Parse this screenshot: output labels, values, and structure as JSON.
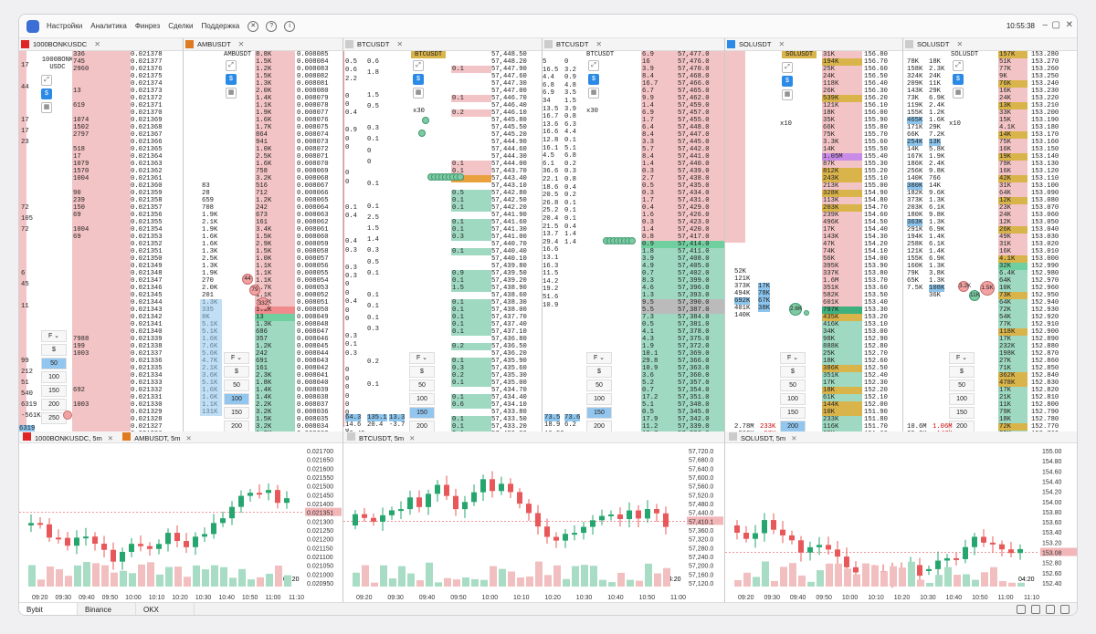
{
  "app": {
    "menu": [
      "Настройки",
      "Аналитика",
      "Финрез",
      "Сделки",
      "Поддержка"
    ],
    "clock": "10:55:38"
  },
  "colors": {
    "ask": "#f3c4c6",
    "bid": "#9fd9c1",
    "accent": "#2a8ae6",
    "red": "#e8585a",
    "green": "#26a66e"
  },
  "panels": [
    {
      "id": "bonk",
      "label": "1000BONKUSDC",
      "color": "#e02424",
      "ladder_label": "1000BONK USDC",
      "ask_prices": [
        "0.021378",
        "0.021377",
        "0.021376",
        "0.021375",
        "0.021374",
        "0.021373",
        "0.021372",
        "0.021371",
        "0.021370",
        "0.021369",
        "0.021368",
        "0.021367",
        "0.021366",
        "0.021365",
        "0.021364",
        "0.021363",
        "0.021362",
        "0.021361",
        "0.021360",
        "0.021359",
        "0.021358",
        "0.021357",
        "0.021356",
        "0.021355",
        "0.021354",
        "0.021353",
        "0.021352",
        "0.021351",
        "0.021350",
        "0.021349",
        "0.021348",
        "0.021347",
        "0.021346",
        "0.021345",
        "0.021344",
        "0.021343"
      ],
      "ask_vols": [
        "336",
        "745",
        "2960",
        "",
        "",
        "13",
        "",
        "619",
        "",
        "1074",
        "1502",
        "2797",
        "",
        "518",
        "17",
        "1079",
        "1570",
        "1004",
        "",
        "90",
        "239",
        "150",
        "69",
        "",
        "1004",
        "69",
        "",
        "",
        "",
        "",
        "",
        "",
        "",
        "",
        "",
        ""
      ],
      "bid_prices": [
        "0.021342",
        "0.021341",
        "0.021340",
        "0.021339",
        "0.021338",
        "0.021337",
        "0.021336",
        "0.021335",
        "0.021334",
        "0.021333",
        "0.021332",
        "0.021331",
        "0.021330",
        "0.021329",
        "0.021328",
        "0.021327",
        "0.021326",
        "0.021325",
        "0.021324",
        "0.021323",
        "0.021322",
        "0.021321",
        "0.021320",
        "0.021319",
        "0.021318",
        "0.021317",
        "0.021316",
        "0.021315",
        "0.021314"
      ],
      "bid_vols": [
        "",
        "",
        "",
        "7988",
        "199",
        "1003",
        "",
        "",
        "",
        "",
        "692",
        "",
        "1003",
        "",
        "",
        "",
        "",
        "",
        "",
        "",
        "",
        "",
        "",
        "",
        "",
        "",
        "",
        "",
        "1808"
      ],
      "left_numbers": [
        "17",
        "",
        "44",
        "",
        "",
        "17",
        "17",
        "23",
        "",
        "",
        "",
        "",
        "",
        "72",
        "105",
        "72",
        "",
        "",
        "",
        "6",
        "45",
        "",
        "11",
        "",
        "",
        "",
        "",
        "99",
        "212",
        "51",
        "540",
        "6319",
        "-561K"
      ],
      "bottom": {
        "v1": "6319",
        "v2": "-561K"
      }
    },
    {
      "id": "amb",
      "label": "AMBUSDT",
      "color": "#e07a20",
      "ladder_label": "AMBUSDT",
      "ask_prices": [
        "0.008085",
        "0.008084",
        "0.008083",
        "0.008082",
        "0.008081",
        "0.008080",
        "0.008079",
        "0.008078",
        "0.008077",
        "0.008076",
        "0.008075",
        "0.008074",
        "0.008073",
        "0.008072",
        "0.008071",
        "0.008070",
        "0.008069",
        "0.008068",
        "0.008067",
        "0.008066",
        "0.008065",
        "0.008064",
        "0.008063",
        "0.008062",
        "0.008061",
        "0.008060",
        "0.008059",
        "0.008058",
        "0.008057",
        "0.008056",
        "0.008055",
        "0.008054",
        "0.008053",
        "0.008052",
        "0.008051",
        "0.008050"
      ],
      "ask_vols": [
        "8.8K",
        "1.5K",
        "1.2K",
        "1.5K",
        "1.3K",
        "2.0K",
        "1.4K",
        "1.1K",
        "1.9K",
        "1.6K",
        "1.7K",
        "864",
        "941",
        "1.0K",
        "2.5K",
        "1.6K",
        "758",
        "3.2K",
        "516",
        "712",
        "1.2K",
        "242",
        "673",
        "161",
        "3.4K",
        "1.5K",
        "2.9K",
        "1.5K",
        "1.0K",
        "1.1K",
        "1.1K",
        "1.1K",
        "1.7K",
        "1.1K",
        "1.6K",
        "1.1K"
      ],
      "bid_prices": [
        "0.008049",
        "0.008048",
        "0.008047",
        "0.008046",
        "0.008045",
        "0.008044",
        "0.008043",
        "0.008042",
        "0.008041",
        "0.008040",
        "0.008039",
        "0.008038",
        "0.008037",
        "0.008036",
        "0.008035",
        "0.008034",
        "0.008033",
        "0.008032",
        "0.008031",
        "0.008030"
      ],
      "bid_vols": [
        "13",
        "1.3K",
        "686",
        "357",
        "1.2K",
        "242",
        "691",
        "161",
        "2.3K",
        "1.8K",
        "1.4K",
        "1.4K",
        "2.2K",
        "3.2K",
        "1.5K",
        "3.2K",
        "1.2K",
        "6.2K",
        "1.7K",
        "7.8K"
      ],
      "left_vols": [
        "83",
        "28",
        "659",
        "708",
        "1.9K",
        "2.1K",
        "1.9K",
        "1.6K",
        "1.6K",
        "1.3K",
        "2.5K",
        "1.3K",
        "1.9K",
        "270",
        "2.0K",
        "201",
        "1.3K",
        "335",
        "8K",
        "5.1K",
        "5.1K",
        "1.6K",
        "7.6K",
        "5.6K",
        "4.7K",
        "2.1K",
        "3.6K",
        "5.1K",
        "1.6K",
        "1.6K",
        "1.1K",
        "131K"
      ],
      "bubbles": [
        "44",
        "79",
        "332"
      ]
    },
    {
      "id": "btc1",
      "label": "BTCUSDT",
      "color": "",
      "ladder_label": "BTCUSDT",
      "prices": [
        "57,448.50",
        "57,448.20",
        "57,447.90",
        "57,447.60",
        "57,447.30",
        "57,447.00",
        "57,446.70",
        "57,446.40",
        "57,446.10",
        "57,445.80",
        "57,445.50",
        "57,445.20",
        "57,444.90",
        "57,444.60",
        "57,444.30",
        "57,444.00",
        "57,443.70",
        "57,443.40",
        "57,443.10",
        "57,442.80",
        "57,442.50",
        "57,442.20",
        "57,441.90",
        "57,441.60",
        "57,441.30",
        "57,441.00",
        "57,440.70",
        "57,440.40",
        "57,440.10",
        "57,439.80",
        "57,439.50",
        "57,439.20",
        "57,438.90",
        "57,438.60",
        "57,438.30",
        "57,438.00",
        "57,437.70",
        "57,437.40",
        "57,437.10",
        "57,436.80",
        "57,436.50",
        "57,436.20",
        "57,435.90",
        "57,435.60",
        "57,435.30",
        "57,435.00",
        "57,434.70",
        "57,434.40",
        "57,434.10",
        "57,433.80",
        "57,433.50",
        "57,433.20",
        "57,432.90",
        "57,432.60",
        "57,432.30",
        "57,432.00",
        "57,431.70",
        "57,431.40"
      ],
      "vols": [
        "",
        "",
        "0.1",
        "",
        "",
        "",
        "0.1",
        "",
        "0.2",
        "",
        "",
        "",
        "",
        "",
        "",
        "0.1",
        "0.1",
        "3.1",
        "",
        "0.5",
        "0.1",
        "0.1",
        "",
        "0.1",
        "0.1",
        "0.3",
        "",
        "0.1",
        "",
        "",
        "0.9",
        "0.1",
        "1.5",
        "",
        "0.1",
        "0.1",
        "0.1",
        "0.1",
        "0.1",
        "",
        "0.2",
        "",
        "0.1",
        "0.3",
        "0.2",
        "0.1",
        "",
        "0.1",
        "0.6",
        "",
        "0.1",
        "0.1",
        "0.1",
        "",
        "0.1",
        "0.1",
        "",
        "0.1"
      ],
      "bottom": [
        "64.3",
        "135.1",
        "13.3",
        "14.6",
        "20.4",
        "-3.7"
      ],
      "time": "10:45",
      "time2": "10:50"
    },
    {
      "id": "btc2",
      "label": "BTCUSDT",
      "color": "",
      "ladder_label": "BTCUSDT",
      "prices": [
        "57,477.0",
        "57,476.0",
        "57,470.0",
        "57,468.0",
        "57,466.0",
        "57,465.0",
        "57,462.0",
        "57,459.0",
        "57,457.0",
        "57,455.0",
        "57,448.0",
        "57,447.0",
        "57,445.0",
        "57,442.0",
        "57,441.0",
        "57,440.0",
        "57,439.0",
        "57,438.0",
        "57,435.0",
        "57,434.0",
        "57,431.0",
        "57,429.0",
        "57,426.0",
        "57,423.0",
        "57,420.0",
        "57,417.0",
        "57,414.0",
        "57,411.0",
        "57,408.0",
        "57,405.0",
        "57,402.0",
        "57,399.0",
        "57,396.0",
        "57,393.0",
        "57,390.0",
        "57,387.0",
        "57,384.0",
        "57,381.0",
        "57,378.0",
        "57,375.0",
        "57,372.0",
        "57,369.0",
        "57,366.0",
        "57,363.0",
        "57,360.0",
        "57,357.0",
        "57,354.0",
        "57,351.0",
        "57,348.0",
        "57,345.0",
        "57,342.0",
        "57,339.0",
        "57,336.0",
        "57,333.0",
        "57,330.0",
        "57,327.0",
        "57,324.0",
        "57,321.0",
        "57,318.0",
        "57,315.0",
        "57,312.0",
        "57,309.0",
        "57,306.0"
      ],
      "vols": [
        "6.9",
        "16",
        "3.9",
        "8.4",
        "16.7",
        "6.7",
        "9.9",
        "1.4",
        "6.9",
        "1.7",
        "6.4",
        "8.4",
        "3.3",
        "5.7",
        "8.4",
        "1.4",
        "0.3",
        "2.7",
        "0.5",
        "0.3",
        "1.7",
        "0.4",
        "1.6",
        "0.3",
        "1.4",
        "0.8",
        "0.9",
        "1.8",
        "3.9",
        "4.9",
        "0.7",
        "8.3",
        "4.6",
        "1.3",
        "9.5",
        "5.5",
        "7.3",
        "0.5",
        "4.1",
        "4.3",
        "1.9",
        "10.1",
        "29.8",
        "10.9",
        "3.6",
        "5.2",
        "0.7",
        "17.2",
        "5.1",
        "0.5",
        "17.9",
        "11.2",
        "10.7",
        "18.0",
        "15.5",
        "17.3",
        "10.6",
        "2.4",
        "10.7",
        "5.1",
        "8.3",
        "6.9",
        "2.4"
      ],
      "bottom": [
        "73.5",
        "73.6",
        "18.9",
        "6.2"
      ],
      "time": "10:50"
    },
    {
      "id": "sol1",
      "label": "SOLUSDT",
      "color": "#2a8ae6",
      "ladder_label": "SOLUSDT",
      "prices": [
        "156.80",
        "156.70",
        "156.60",
        "156.50",
        "156.40",
        "156.30",
        "156.20",
        "156.10",
        "156.00",
        "155.90",
        "155.80",
        "155.70",
        "155.60",
        "155.50",
        "155.40",
        "155.30",
        "155.20",
        "155.10",
        "155.00",
        "154.90",
        "154.80",
        "154.70",
        "154.60",
        "154.50",
        "154.40",
        "154.30",
        "154.20",
        "154.10",
        "154.00",
        "153.90",
        "153.80",
        "153.70",
        "153.60",
        "153.50",
        "153.40",
        "153.30",
        "153.20",
        "153.10",
        "153.00",
        "152.90",
        "152.80",
        "152.70",
        "152.60",
        "152.50",
        "152.40",
        "152.30",
        "152.20",
        "152.10",
        "152.00",
        "151.90",
        "151.80",
        "151.70",
        "151.60",
        "151.50",
        "151.40",
        "151.30",
        "151.20",
        "151.10",
        "151.00"
      ],
      "vols": [
        "31K",
        "194K",
        "25K",
        "24K",
        "118K",
        "26K",
        "539K",
        "121K",
        "18K",
        "35K",
        "66K",
        "75K",
        "3.3K",
        "14K",
        "1.05M",
        "87K",
        "812K",
        "243K",
        "213K",
        "328K",
        "113K",
        "203K",
        "239K",
        "496K",
        "17K",
        "143K",
        "47K",
        "74K",
        "56K",
        "395K",
        "337K",
        "1.6M",
        "351K",
        "582K",
        "601K",
        "797K",
        "435K",
        "416K",
        "34K",
        "98K",
        "888K",
        "25K",
        "18K",
        "386K",
        "351K",
        "17K",
        "18K",
        "61K",
        "144K",
        "10K",
        "233K",
        "116K",
        "60K",
        "11K",
        "32K",
        "73K",
        "12K",
        "18K",
        "10K"
      ],
      "mid": [
        "52K",
        "121K",
        "373K",
        "494K",
        "692K",
        "401K",
        "140K"
      ],
      "mid2": [
        "17K",
        "78K",
        "67K",
        "38K"
      ],
      "bottom": [
        "2.78M",
        "233K",
        "-262K",
        "-57K"
      ]
    },
    {
      "id": "sol2",
      "label": "SOLUSDT",
      "color": "",
      "ladder_label": "SOLUSDT",
      "left": [
        "78K",
        "158K",
        "324K",
        "209K",
        "143K",
        "73K",
        "119K",
        "155K",
        "465K",
        "171K",
        "66K",
        "254K",
        "14K",
        "167K",
        "186K",
        "256K",
        "140K",
        "380K",
        "182K",
        "373K",
        "203K",
        "180K",
        "363K",
        "291K",
        "194K",
        "258K",
        "121K",
        "155K",
        "160K",
        "79K",
        "65K",
        "7.5K"
      ],
      "left2": [
        "18K",
        "2.3K",
        "24K",
        "11K",
        "29K",
        "6.9K",
        "2.4K",
        "1.2K",
        "1.6K",
        "29K",
        "7.2K",
        "13K",
        "5.8K",
        "1.9K",
        "2.4K",
        "9.8K",
        "766",
        "14K",
        "9.6K",
        "1.3K",
        "6.1K",
        "9.8K",
        "1.3K",
        "6.9K",
        "1.4K",
        "6.1K",
        "1.4K",
        "6.9K",
        "1.3K",
        "3.8K",
        "1.3K",
        "108K",
        "36K"
      ],
      "prices": [
        "153.280",
        "153.270",
        "153.260",
        "153.250",
        "153.240",
        "153.230",
        "153.220",
        "153.210",
        "153.200",
        "153.190",
        "153.180",
        "153.170",
        "153.160",
        "153.150",
        "153.140",
        "153.130",
        "153.120",
        "153.110",
        "153.100",
        "153.090",
        "153.080",
        "153.070",
        "153.060",
        "153.050",
        "153.040",
        "153.030",
        "153.020",
        "153.010",
        "153.000",
        "152.990",
        "152.980",
        "152.970",
        "152.960",
        "152.950",
        "152.940",
        "152.930",
        "152.920",
        "152.910",
        "152.900",
        "152.890",
        "152.880",
        "152.870",
        "152.860",
        "152.850",
        "152.840",
        "152.830",
        "152.820",
        "152.810",
        "152.800",
        "152.790",
        "152.780",
        "152.770",
        "152.760",
        "152.750",
        "152.740",
        "152.730",
        "152.720",
        "152.710"
      ],
      "vols": [
        "157K",
        "51K",
        "77K",
        "9K",
        "76K",
        "16K",
        "24K",
        "13K",
        "33K",
        "15K",
        "4.1K",
        "14K",
        "75K",
        "16K",
        "19K",
        "79K",
        "16K",
        "42K",
        "31K",
        "64K",
        "12K",
        "23K",
        "24K",
        "12K",
        "26K",
        "49K",
        "31K",
        "16K",
        "4.1K",
        "32K",
        "6.4K",
        "64K",
        "10K",
        "73K",
        "64K",
        "72K",
        "54K",
        "77K",
        "118K",
        "17K",
        "232K",
        "198K",
        "27K",
        "71K",
        "362K",
        "478K",
        "17K",
        "21K",
        "11K",
        "79K",
        "18K",
        "72K",
        "29K",
        "28K",
        "87K",
        "48K",
        "54K",
        "11K"
      ],
      "bottom": [
        "10.6M",
        "1.06M",
        "29.2K",
        "-147K"
      ],
      "bubbles": [
        "3.2K",
        "1.5K",
        "11K"
      ]
    }
  ],
  "charts": [
    {
      "id": "chart-bonk",
      "tabs": [
        "1000BONKUSDC, 5m",
        "AMBUSDT, 5m"
      ],
      "y_labels": [
        "0.021700",
        "0.021650",
        "0.021600",
        "0.021550",
        "0.021500",
        "0.021450",
        "0.021400",
        "0.021351",
        "0.021300",
        "0.021250",
        "0.021200",
        "0.021150",
        "0.021100",
        "0.021050",
        "0.021000",
        "0.020950"
      ],
      "x_labels": [
        "09:20",
        "09:30",
        "09:40",
        "09:50",
        "10:00",
        "10:10",
        "10:20",
        "10:30",
        "10:40",
        "10:50",
        "11:00",
        "11:10"
      ],
      "countdown": "04:20",
      "last": "0.021351"
    },
    {
      "id": "chart-btc",
      "tabs": [
        "BTCUSDT, 5m"
      ],
      "y_labels": [
        "57,720.0",
        "57,680.0",
        "57,640.0",
        "57,600.0",
        "57,560.0",
        "57,520.0",
        "57,480.0",
        "57,440.0",
        "57,410.1",
        "57,360.0",
        "57,320.0",
        "57,280.0",
        "57,240.0",
        "57,200.0",
        "57,160.0",
        "57,120.0"
      ],
      "x_labels": [
        "09:20",
        "09:30",
        "09:40",
        "09:50",
        "10:00",
        "10:10",
        "10:20",
        "10:30",
        "10:40",
        "10:50",
        "11:00"
      ],
      "countdown": "04:20",
      "last": "57,410.1"
    },
    {
      "id": "chart-sol",
      "tabs": [
        "SOLUSDT, 5m"
      ],
      "y_labels": [
        "155.00",
        "154.80",
        "154.60",
        "154.40",
        "154.20",
        "154.00",
        "153.80",
        "153.60",
        "153.40",
        "153.20",
        "153.08",
        "152.80",
        "152.60",
        "152.40"
      ],
      "x_labels": [
        "09:20",
        "09:30",
        "09:40",
        "09:50",
        "10:00",
        "10:10",
        "10:20",
        "10:30",
        "10:40",
        "10:50",
        "11:00",
        "11:10"
      ],
      "countdown": "04:20",
      "last": "153.08"
    }
  ],
  "bottom_tabs": [
    "Bybit",
    "Binance",
    "OKX"
  ],
  "qty_values": [
    "50",
    "100",
    "150",
    "200",
    "250"
  ],
  "multiplier": "x10",
  "multiplier_btc": "x30"
}
